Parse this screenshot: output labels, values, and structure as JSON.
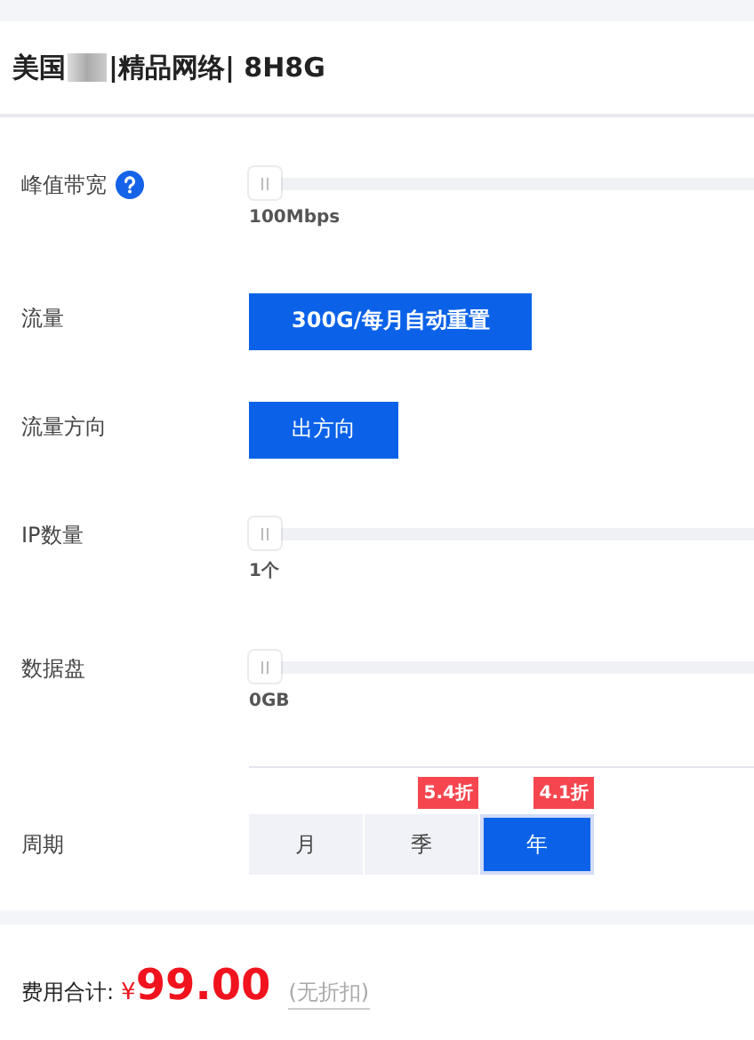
{
  "title": {
    "before": "美国",
    "after": "|精品网络| 8H8G"
  },
  "rows": [
    {
      "kind": "slider",
      "label": "峰值带宽",
      "help": true,
      "reading": "100Mbps"
    },
    {
      "kind": "button",
      "label": "流量",
      "value": "300G/每月自动重置"
    },
    {
      "kind": "button",
      "label": "流量方向",
      "value": "出方向"
    },
    {
      "kind": "slider",
      "label": "IP数量",
      "reading": "1个"
    },
    {
      "kind": "slider",
      "label": "数据盘",
      "reading": "0GB"
    }
  ],
  "period": {
    "label": "周期",
    "options": [
      {
        "label": "月",
        "selected": false
      },
      {
        "label": "季",
        "selected": false,
        "badge": "5.4折"
      },
      {
        "label": "年",
        "selected": true,
        "badge": "4.1折"
      }
    ]
  },
  "total": {
    "label": "费用合计:",
    "currency": "¥",
    "amount": "99.00",
    "note": "(无折扣)"
  }
}
